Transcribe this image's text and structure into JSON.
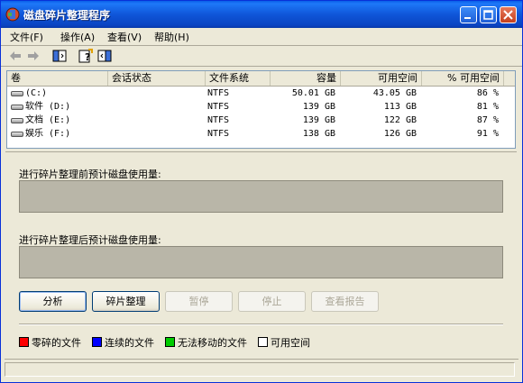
{
  "window": {
    "title": "磁盘碎片整理程序"
  },
  "menu": [
    {
      "label": "文件(F)"
    },
    {
      "label": "操作(A)"
    },
    {
      "label": "查看(V)"
    },
    {
      "label": "帮助(H)"
    }
  ],
  "toolbar": {
    "icons": [
      "back-icon",
      "forward-icon",
      "show-hide-console-tree-icon",
      "help-icon",
      "properties-pane-icon"
    ]
  },
  "table": {
    "columns": [
      "卷",
      "会话状态",
      "文件系统",
      "容量",
      "可用空间",
      "% 可用空间"
    ],
    "rows": [
      {
        "volume": "(C:)",
        "status": "",
        "fs": "NTFS",
        "capacity": "50.01 GB",
        "free": "43.05 GB",
        "pct": "86 %"
      },
      {
        "volume": "软件 (D:)",
        "status": "",
        "fs": "NTFS",
        "capacity": "139 GB",
        "free": "113 GB",
        "pct": "81 %"
      },
      {
        "volume": "文档 (E:)",
        "status": "",
        "fs": "NTFS",
        "capacity": "139 GB",
        "free": "122 GB",
        "pct": "87 %"
      },
      {
        "volume": "娱乐 (F:)",
        "status": "",
        "fs": "NTFS",
        "capacity": "138 GB",
        "free": "126 GB",
        "pct": "91 %"
      }
    ]
  },
  "before_label": "进行碎片整理前预计磁盘使用量:",
  "after_label": "进行碎片整理后预计磁盘使用量:",
  "buttons": {
    "analyze": "分析",
    "defrag": "碎片整理",
    "pause": "暂停",
    "stop": "停止",
    "report": "查看报告"
  },
  "legend": [
    {
      "label": "零碎的文件",
      "color": "#ff0000"
    },
    {
      "label": "连续的文件",
      "color": "#0000ff"
    },
    {
      "label": "无法移动的文件",
      "color": "#00cc00"
    },
    {
      "label": "可用空间",
      "color": "#ffffff"
    }
  ]
}
